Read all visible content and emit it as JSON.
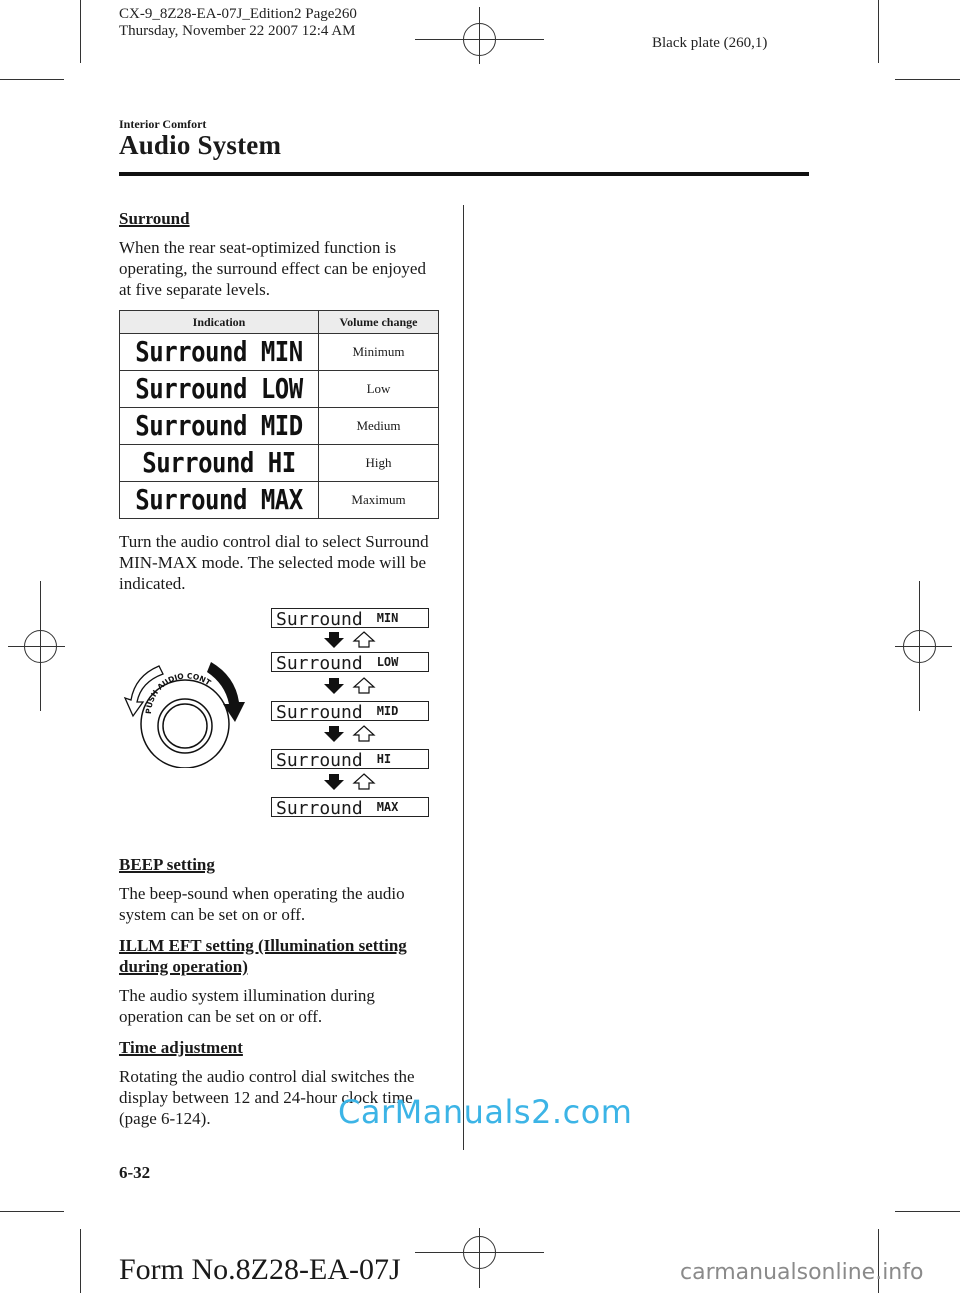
{
  "print_header": {
    "line1": "CX-9_8Z28-EA-07J_Edition2 Page260",
    "line2": "Thursday, November 22 2007 12:4 AM",
    "plate": "Black plate (260,1)"
  },
  "section_label": "Interior Comfort",
  "page_title": "Audio System",
  "content": {
    "surround": {
      "heading": "Surround",
      "intro": "When the rear seat-optimized function is operating, the surround effect can be enjoyed at five separate levels.",
      "table": {
        "headers": [
          "Indication",
          "Volume change"
        ],
        "rows": [
          {
            "indication": "Surround MIN",
            "volume": "Minimum"
          },
          {
            "indication": "Surround LOW",
            "volume": "Low"
          },
          {
            "indication": "Surround MID",
            "volume": "Medium"
          },
          {
            "indication": "Surround HI",
            "volume": "High"
          },
          {
            "indication": "Surround MAX",
            "volume": "Maximum"
          }
        ]
      },
      "instruction": "Turn the audio control dial to select Surround MIN-MAX mode. The selected mode will be indicated."
    },
    "figure": {
      "dial_label": "PUSH AUDIO CONT",
      "display_prefix": "Surround",
      "levels": [
        "MIN",
        "LOW",
        "MID",
        "HI",
        "MAX"
      ]
    },
    "beep": {
      "heading": "BEEP setting",
      "text": "The beep-sound when operating the audio system can be set on or off."
    },
    "illm": {
      "heading": "ILLM EFT setting (Illumination setting during operation)",
      "text": "The audio system illumination during operation can be set on or off."
    },
    "time": {
      "heading": "Time adjustment",
      "text": "Rotating the audio control dial switches the display between 12 and 24-hour clock time (page 6-124)."
    }
  },
  "footer": {
    "page_number": "6-32",
    "form_number": "Form No.8Z28-EA-07J"
  },
  "watermarks": {
    "primary": "CarManuals2.com",
    "secondary": "carmanualsonline.info"
  },
  "colors": {
    "watermark_primary": "#3cb4e6",
    "watermark_secondary": "#8a8a8a"
  }
}
